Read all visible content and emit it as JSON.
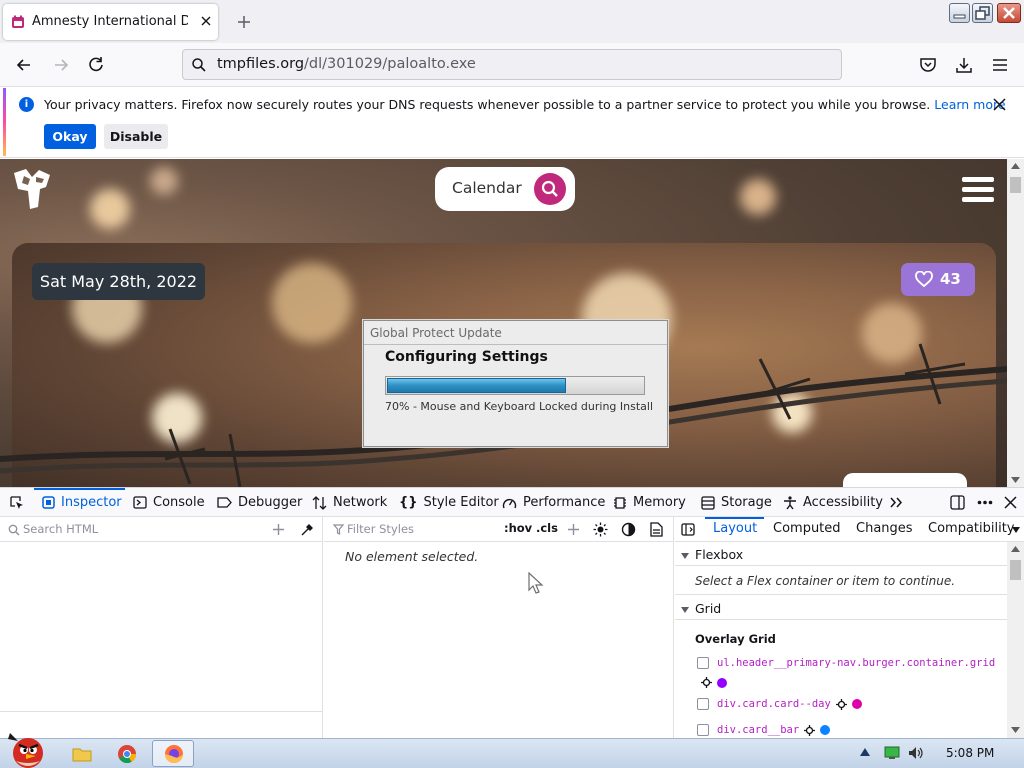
{
  "browser": {
    "tab": {
      "title_main": "Amnesty International Day (",
      "title_fade": "M"
    },
    "url": {
      "host": "tmpfiles.org",
      "path": "/dl/301029/paloalto.exe"
    }
  },
  "notification": {
    "text": "Your privacy matters. Firefox now securely routes your DNS requests whenever possible to a partner service to protect you while you browse.",
    "learn_more": "Learn more",
    "okay": "Okay",
    "disable": "Disable"
  },
  "site": {
    "calendar_label": "Calendar",
    "date": "Sat May 28th, 2022",
    "likes": "43"
  },
  "dialog": {
    "title": "Global Protect Update",
    "heading": "Configuring Settings",
    "progress_percent": 70,
    "status": "70% - Mouse and Keyboard Locked during Install"
  },
  "devtools": {
    "tabs": {
      "inspector": "Inspector",
      "console": "Console",
      "debugger": "Debugger",
      "network": "Network",
      "style_editor": "Style Editor",
      "performance": "Performance",
      "memory": "Memory",
      "storage": "Storage",
      "accessibility": "Accessibility"
    },
    "search_placeholder": "Search HTML",
    "filter_placeholder": "Filter Styles",
    "hov": ":hov",
    "cls": ".cls",
    "no_element": "No element selected.",
    "right_tabs": {
      "layout": "Layout",
      "computed": "Computed",
      "changes": "Changes",
      "compatibility": "Compatibility"
    },
    "flexbox": {
      "heading": "Flexbox",
      "note": "Select a Flex container or item to continue."
    },
    "grid": {
      "heading": "Grid",
      "overlay_heading": "Overlay Grid",
      "items": [
        {
          "selector": "ul.header__primary-nav.burger.container.grid",
          "color": "#9400ff"
        },
        {
          "selector": "div.card.card--day",
          "color": "#df00a9"
        },
        {
          "selector": "div.card__bar",
          "color": "#0a84ff"
        }
      ]
    }
  },
  "taskbar": {
    "clock": "5:08 PM"
  },
  "colors": {
    "accent": "#0060df",
    "search_circle": "#c0297b",
    "likes_badge": "#9b74d8",
    "progress": "#2e90c4"
  }
}
